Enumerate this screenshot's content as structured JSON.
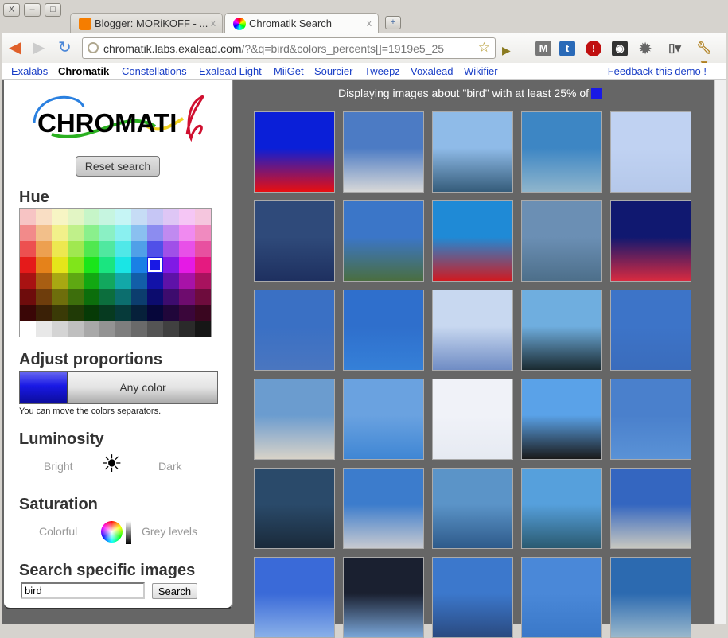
{
  "window": {
    "close": "X",
    "minimize": "–",
    "maximize": "□"
  },
  "tabs": [
    {
      "label": "Blogger: MORiKOFF - ...",
      "close": "x"
    },
    {
      "label": "Chromatik Search",
      "close": "x"
    }
  ],
  "new_tab": "+",
  "omnibox": {
    "host": "chromatik.labs.exalead.com",
    "path": "/?&q=bird&colors_percents[]=1919e5_25"
  },
  "links": [
    {
      "label": "Exalabs"
    },
    {
      "label": "Chromatik",
      "current": true
    },
    {
      "label": "Constellations"
    },
    {
      "label": "Exalead Light"
    },
    {
      "label": "MiiGet"
    },
    {
      "label": "Sourcier"
    },
    {
      "label": "Tweepz"
    },
    {
      "label": "Voxalead"
    },
    {
      "label": "Wikifier"
    }
  ],
  "feedback": "Feedback this demo !",
  "sidebar": {
    "logo_text": "CHROMATIK",
    "reset": "Reset search",
    "hue_title": "Hue",
    "selected_color": "#1919e5",
    "palette": [
      [
        "#f7c4c4",
        "#f9dec4",
        "#f7f5c4",
        "#e2f5c4",
        "#c6f5c8",
        "#c6f5e0",
        "#c6f5f5",
        "#c6dcf5",
        "#c6c6f5",
        "#dec6f5",
        "#f5c6f5",
        "#f5c6de"
      ],
      [
        "#f28a8a",
        "#f2bf8a",
        "#f2f08a",
        "#c0f08a",
        "#8af08c",
        "#8af0c4",
        "#8af0f0",
        "#8ac0f0",
        "#8c8cf0",
        "#c08af0",
        "#f08af0",
        "#f08abf"
      ],
      [
        "#ed5050",
        "#eda050",
        "#ede850",
        "#a0e850",
        "#50e850",
        "#50e8a0",
        "#50e8e8",
        "#50a0e8",
        "#5050e8",
        "#a050e8",
        "#e850e8",
        "#e850a0"
      ],
      [
        "#e51a1a",
        "#e5821a",
        "#e5e51a",
        "#80e51a",
        "#1ae51a",
        "#1ae580",
        "#1ae5e5",
        "#1a80e5",
        "#1919e5",
        "#801ae5",
        "#e51ae5",
        "#e51a80"
      ],
      [
        "#a81212",
        "#a85e12",
        "#a8a812",
        "#5ea812",
        "#12a812",
        "#12a85e",
        "#12a8a8",
        "#125ea8",
        "#1212a8",
        "#5e12a8",
        "#a812a8",
        "#a8125e"
      ],
      [
        "#6e0c0c",
        "#6e3d0c",
        "#6e6e0c",
        "#3d6e0c",
        "#0c6e0c",
        "#0c6e3d",
        "#0c6e6e",
        "#0c3d6e",
        "#0c0c6e",
        "#3d0c6e",
        "#6e0c6e",
        "#6e0c3d"
      ],
      [
        "#3a0606",
        "#3a2006",
        "#3a3a06",
        "#203a06",
        "#063a06",
        "#063a20",
        "#063a3a",
        "#06203a",
        "#06063a",
        "#20063a",
        "#3a063a",
        "#3a0620"
      ],
      [
        "#ffffff",
        "#e8e8e8",
        "#d4d4d4",
        "#bfbfbf",
        "#a8a8a8",
        "#939393",
        "#7e7e7e",
        "#6a6a6a",
        "#545454",
        "#404040",
        "#2a2a2a",
        "#161616"
      ]
    ],
    "proportions_title": "Adjust proportions",
    "any_color": "Any color",
    "hint": "You can move the colors separators.",
    "luminosity_title": "Luminosity",
    "bright": "Bright",
    "dark": "Dark",
    "saturation_title": "Saturation",
    "colorful": "Colorful",
    "grey": "Grey levels",
    "search_title": "Search specific images",
    "search_value": "bird",
    "search_button": "Search"
  },
  "results": {
    "caption": "Displaying images about \"bird\" with at least 25% of",
    "thumbs": [
      [
        "#0a1fd8",
        "#e80f10"
      ],
      [
        "#4c7bc4",
        "#d8d8d8"
      ],
      [
        "#8fbbe8",
        "#355c7a"
      ],
      [
        "#3d86c4",
        "#8fb5cc"
      ],
      [
        "#c0d2f2",
        "#b5c8ea"
      ],
      [
        "#2f4a7a",
        "#1e3060"
      ],
      [
        "#3b76c8",
        "#4a6e40"
      ],
      [
        "#1f8ad6",
        "#d01a20"
      ],
      [
        "#6b8fb4",
        "#4d6f8a"
      ],
      [
        "#101870",
        "#d82a40"
      ],
      [
        "#3a70c4",
        "#4a76c0"
      ],
      [
        "#2f6fcc",
        "#3580d8"
      ],
      [
        "#c8d8f0",
        "#6f8cc4"
      ],
      [
        "#6faedf",
        "#1a2a30"
      ],
      [
        "#3d74c8",
        "#3a6cbc"
      ],
      [
        "#6b9ccf",
        "#d8d2c8"
      ],
      [
        "#6aa2e0",
        "#3f86d4"
      ],
      [
        "#f0f2f8",
        "#e6eaf2"
      ],
      [
        "#5aa2e8",
        "#1a1a1a"
      ],
      [
        "#4a80cc",
        "#5a92d6"
      ],
      [
        "#2a4a6a",
        "#1a2a3a"
      ],
      [
        "#3c7ccc",
        "#c8cad0"
      ],
      [
        "#5b94c8",
        "#2e5a8a"
      ],
      [
        "#56a0dc",
        "#2a5a70"
      ],
      [
        "#3466c0",
        "#c8c8c0"
      ],
      [
        "#3a6ad8",
        "#8ab0e8"
      ],
      [
        "#1a2030",
        "#7aa6d8"
      ],
      [
        "#3c78cc",
        "#2a4a80"
      ],
      [
        "#4a88d8",
        "#3a78c8"
      ],
      [
        "#2c6ab0",
        "#9ab8cc"
      ]
    ]
  }
}
